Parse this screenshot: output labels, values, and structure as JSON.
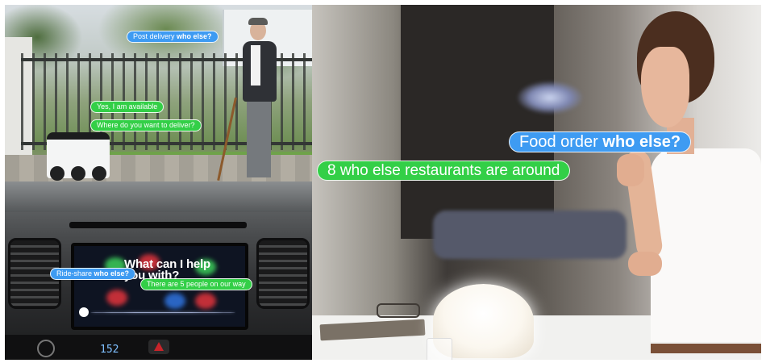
{
  "bubbles": {
    "post_delivery": {
      "prefix": "Post delivery ",
      "bold": "who else?"
    },
    "available": "Yes, I am available",
    "where_deliver": "Where do you want to deliver?",
    "ride_share": {
      "prefix": "Ride-share ",
      "bold": "who else?"
    },
    "five_people": "There are 5 people on our way",
    "food_order": {
      "prefix": "Food order ",
      "bold": "who else?"
    },
    "restaurants": "8 who else restaurants are around"
  },
  "car_screen": {
    "prompt": "What can I help you with?",
    "temperature": "152"
  },
  "colors": {
    "question_bubble": "#3e9bf2",
    "answer_bubble": "#33cf47"
  }
}
